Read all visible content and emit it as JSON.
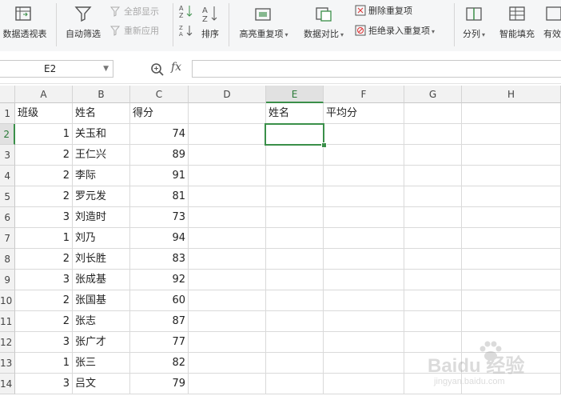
{
  "ribbon": {
    "pivot": "数据透视表",
    "autofilter": "自动筛选",
    "show_all": "全部显示",
    "reapply": "重新应用",
    "sort": "排序",
    "highlight_dup": "高亮重复项",
    "data_compare": "数据对比",
    "delete_dup": "删除重复项",
    "reject_dup": "拒绝录入重复项",
    "split": "分列",
    "smart_fill": "智能填充",
    "validity": "有效"
  },
  "formula_bar": {
    "name_box": "E2",
    "fx": "fx",
    "formula": ""
  },
  "columns": [
    "A",
    "B",
    "C",
    "D",
    "E",
    "F",
    "G",
    "H"
  ],
  "rows": [
    "1",
    "2",
    "3",
    "4",
    "5",
    "6",
    "7",
    "8",
    "9",
    "10",
    "11",
    "12",
    "13",
    "14"
  ],
  "header_row": {
    "A": "班级",
    "B": "姓名",
    "C": "得分",
    "E": "姓名",
    "F": "平均分"
  },
  "data_rows": [
    {
      "class": "1",
      "name": "关玉和",
      "score": "74"
    },
    {
      "class": "2",
      "name": "王仁兴",
      "score": "89"
    },
    {
      "class": "2",
      "name": "李际",
      "score": "91"
    },
    {
      "class": "2",
      "name": "罗元发",
      "score": "81"
    },
    {
      "class": "3",
      "name": "刘造时",
      "score": "73"
    },
    {
      "class": "1",
      "name": "刘乃",
      "score": "94"
    },
    {
      "class": "2",
      "name": "刘长胜",
      "score": "83"
    },
    {
      "class": "3",
      "name": "张成基",
      "score": "92"
    },
    {
      "class": "2",
      "name": "张国基",
      "score": "60"
    },
    {
      "class": "2",
      "name": "张志",
      "score": "87"
    },
    {
      "class": "3",
      "name": "张广才",
      "score": "77"
    },
    {
      "class": "1",
      "name": "张三",
      "score": "82"
    },
    {
      "class": "3",
      "name": "吕文",
      "score": "79"
    }
  ],
  "watermark": {
    "brand": "Baidu 经验",
    "url": "jingyan.baidu.com"
  },
  "colors": {
    "selection": "#3a8f49",
    "header_bg": "#f2f2f2"
  }
}
